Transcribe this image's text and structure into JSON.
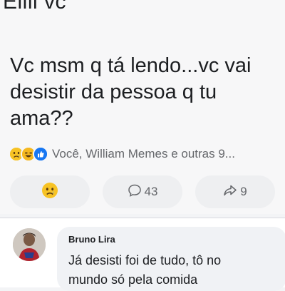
{
  "post": {
    "cut_line": "Eiiii vc",
    "text_lines": [
      "Vc msm q tá lendo...vc vai",
      "desistir da pessoa q tu",
      "ama??"
    ],
    "reactions": {
      "icons": [
        "sad-reaction",
        "haha-reaction",
        "like-reaction"
      ],
      "summary": "Você, William Memes e outras 9..."
    },
    "actions": {
      "react_icon": "sad-reaction",
      "comments_count": "43",
      "shares_count": "9"
    }
  },
  "comment": {
    "author": "Bruno Lira",
    "text_lines": [
      "Já desisti foi de tudo, tô no",
      "mundo só pela comida"
    ]
  },
  "colors": {
    "text_primary": "#1c1e21",
    "text_secondary": "#65676b",
    "like_blue": "#1877f2",
    "reaction_yellow": "#f7c325"
  }
}
